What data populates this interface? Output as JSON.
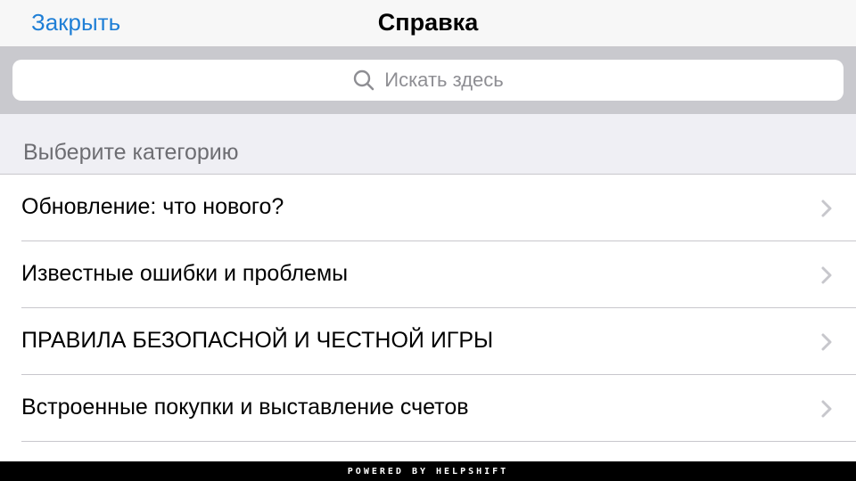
{
  "navbar": {
    "close_label": "Закрыть",
    "title": "Справка"
  },
  "search": {
    "placeholder": "Искать здесь",
    "icon": "search-icon"
  },
  "section": {
    "title": "Выберите категорию"
  },
  "categories": [
    {
      "label": "Обновление: что нового?",
      "icon": "chevron-right-icon"
    },
    {
      "label": "Известные ошибки и проблемы",
      "icon": "chevron-right-icon"
    },
    {
      "label": "ПРАВИЛА БЕЗОПАСНОЙ И ЧЕСТНОЙ ИГРЫ",
      "icon": "chevron-right-icon"
    },
    {
      "label": "Встроенные покупки и выставление счетов",
      "icon": "chevron-right-icon"
    }
  ],
  "footer": {
    "text": "POWERED BY HELPSHIFT"
  },
  "colors": {
    "accent": "#1f7fd6",
    "search_bg": "#c9c9ce",
    "section_bg": "#efeff4",
    "footer_bg": "#000000"
  }
}
